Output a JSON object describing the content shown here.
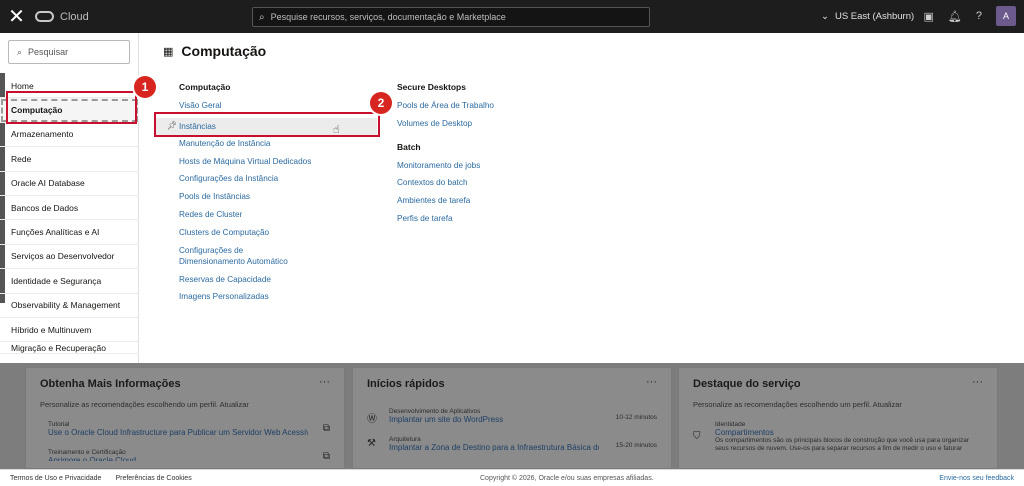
{
  "topbar": {
    "brand": "Cloud",
    "search_placeholder": "Pesquise recursos, serviços, documentação e Marketplace",
    "region": "US East (Ashburn)",
    "avatar_initial": "A"
  },
  "left_menu": {
    "search_placeholder": "Pesquisar",
    "items": [
      "Home",
      "Computação",
      "Armazenamento",
      "Rede",
      "Oracle AI Database",
      "Bancos de Dados",
      "Funções Analíticas e AI",
      "Serviços ao Desenvolvedor",
      "Identidade e Segurança",
      "Observability & Management",
      "Híbrido e Multinuvem",
      "Migração e Recuperação"
    ]
  },
  "pane": {
    "title": "Computação",
    "col1": {
      "heading": "Computação",
      "links": [
        "Visão Geral",
        "Instâncias",
        "Manutenção de Instância",
        "Hosts de Máquina Virtual Dedicados",
        "Configurações da Instância",
        "Pools de Instâncias",
        "Redes de Cluster",
        "Clusters de Computação",
        "Configurações de Dimensionamento Automático",
        "Reservas de Capacidade",
        "Imagens Personalizadas"
      ]
    },
    "col2": {
      "heading1": "Secure Desktops",
      "links1": [
        "Pools de Área de Trabalho",
        "Volumes de Desktop"
      ],
      "heading2": "Batch",
      "links2": [
        "Monitoramento de jobs",
        "Contextos do batch",
        "Ambientes de tarefa",
        "Perfis de tarefa"
      ]
    }
  },
  "annotations": {
    "badge1": "1",
    "badge2": "2"
  },
  "cards": {
    "c1": {
      "title": "Obtenha Mais Informações",
      "sub": "Personalize as recomendações escolhendo um perfil. Atualizar",
      "r1_small": "Tutorial",
      "r1_link": "Use o Oracle Cloud Infrastructure para Publicar um Servidor Web Acessível",
      "r2_small": "Treinamento e Certificação",
      "r2_link": "Aprimore o Oracle Cloud"
    },
    "c2": {
      "title": "Inícios rápidos",
      "r1_small": "Desenvolvimento de Aplicativos",
      "r1_link": "Implantar um site do WordPress",
      "r1_time": "10-12 minutos",
      "r2_small": "Arquitetura",
      "r2_link": "Implantar a Zona de Destino para a Infraestrutura Básica do",
      "r2_time": "15-20 minutos"
    },
    "c3": {
      "title": "Destaque do serviço",
      "sub": "Personalize as recomendações escolhendo um perfil. Atualizar",
      "r1_small": "Identidade",
      "r1_link": "Compartimentos",
      "r1_desc": "Os compartimentos são os principais blocos de construção que você usa para organizar seus recursos de nuvem. Use-os para separar recursos a fim de medir o uso e faturar"
    }
  },
  "footer": {
    "terms": "Termos de Uso e Privacidade",
    "cookies": "Preferências de Cookies",
    "copyright": "Copyright © 2026, Oracle e/ou suas empresas afiliadas.",
    "feedback": "Envie-nos seu feedback"
  }
}
